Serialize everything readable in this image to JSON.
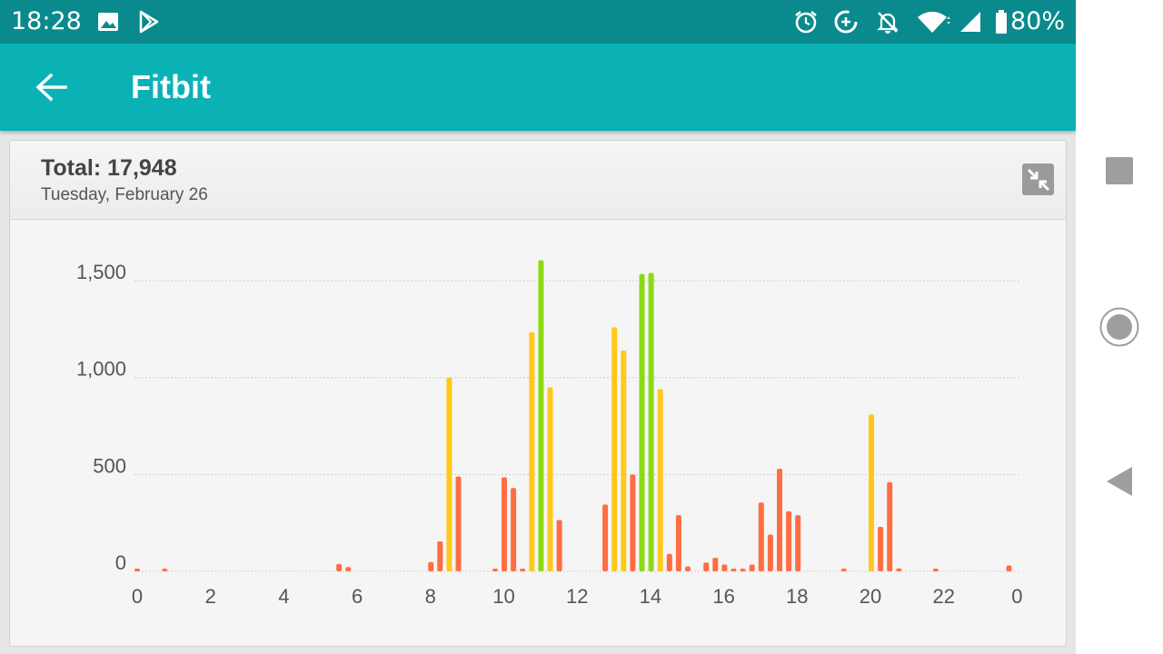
{
  "status_bar": {
    "time": "18:28",
    "battery": "80%",
    "icons": [
      "image-icon",
      "play-store-icon",
      "alarm-icon",
      "data-saver-icon",
      "notifications-off-icon",
      "wifi-icon",
      "signal-icon",
      "battery-icon"
    ]
  },
  "app_bar": {
    "title": "Fitbit",
    "back_icon": "arrow-left-icon",
    "color": "#0ab2b5"
  },
  "card": {
    "total": "Total: 17,948",
    "date": "Tuesday, February 26",
    "collapse_icon": "collapse-icon"
  },
  "colors": {
    "low": "#ff6d42",
    "medium": "#ffc81a",
    "high": "#8cd916"
  },
  "chart_data": {
    "type": "bar",
    "title": "",
    "xlabel": "",
    "ylabel": "",
    "ylim": [
      0,
      1650
    ],
    "y_ticks": [
      {
        "value": 0,
        "label": "0"
      },
      {
        "value": 500,
        "label": "500"
      },
      {
        "value": 1000,
        "label": "1,000"
      },
      {
        "value": 1500,
        "label": "1,500"
      }
    ],
    "x_ticks": [
      "0",
      "2",
      "4",
      "6",
      "8",
      "10",
      "12",
      "14",
      "16",
      "18",
      "20",
      "22",
      "0"
    ],
    "interval_minutes": 15,
    "values": [
      5,
      0,
      0,
      3,
      0,
      0,
      0,
      0,
      0,
      0,
      0,
      0,
      0,
      0,
      0,
      0,
      0,
      0,
      0,
      0,
      0,
      0,
      38,
      22,
      0,
      0,
      0,
      0,
      0,
      0,
      0,
      0,
      48,
      155,
      1000,
      490,
      0,
      0,
      0,
      10,
      485,
      430,
      3,
      1235,
      1605,
      950,
      265,
      0,
      0,
      0,
      0,
      345,
      1260,
      1140,
      500,
      1535,
      1540,
      940,
      90,
      290,
      25,
      0,
      45,
      70,
      35,
      10,
      8,
      35,
      355,
      190,
      530,
      310,
      290,
      0,
      0,
      0,
      0,
      2,
      0,
      0,
      810,
      230,
      460,
      15,
      0,
      0,
      0,
      2,
      0,
      0,
      0,
      0,
      0,
      0,
      0,
      30
    ],
    "grid": true,
    "legend": "none"
  },
  "nav_bar": {
    "icons": [
      "recents-icon",
      "home-icon",
      "back-triangle-icon"
    ]
  }
}
